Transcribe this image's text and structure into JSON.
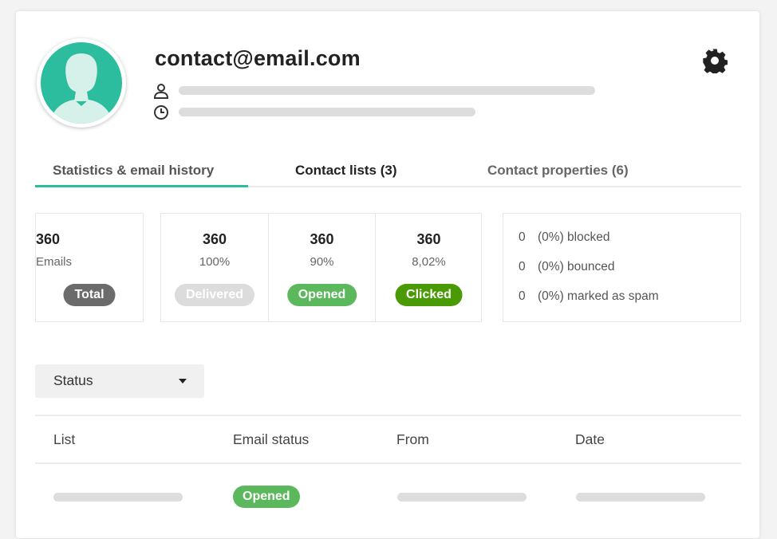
{
  "contact": {
    "email": "contact@email.com"
  },
  "icons": {
    "avatar": "female-user-silhouette-icon",
    "person": "person-outline-icon",
    "clock": "clock-outline-icon",
    "settings": "gear-icon",
    "dropdown": "caret-down-icon"
  },
  "colors": {
    "accent": "#2bbd9e",
    "total": "#6b6b6b",
    "delivered": "#dcdcdc",
    "opened": "#5cb85c",
    "clicked": "#4a9a06"
  },
  "tabs": [
    {
      "label": "Statistics & email history",
      "active": true
    },
    {
      "label": "Contact lists (3)",
      "active": false
    },
    {
      "label": "Contact properties (6)",
      "active": false
    }
  ],
  "stats": {
    "total": {
      "value": "360",
      "sub": "Emails",
      "badge": "Total"
    },
    "delivered": {
      "value": "360",
      "sub": "100%",
      "badge": "Delivered"
    },
    "opened": {
      "value": "360",
      "sub": "90%",
      "badge": "Opened"
    },
    "clicked": {
      "value": "360",
      "sub": "8,02%",
      "badge": "Clicked"
    }
  },
  "issues": [
    {
      "count": "0",
      "text": "(0%) blocked"
    },
    {
      "count": "0",
      "text": "(0%) bounced"
    },
    {
      "count": "0",
      "text": "(0%) marked as spam"
    }
  ],
  "filter": {
    "label": "Status"
  },
  "table": {
    "headers": [
      "List",
      "Email status",
      "From",
      "Date"
    ],
    "rows": [
      {
        "status": "Opened"
      }
    ]
  }
}
